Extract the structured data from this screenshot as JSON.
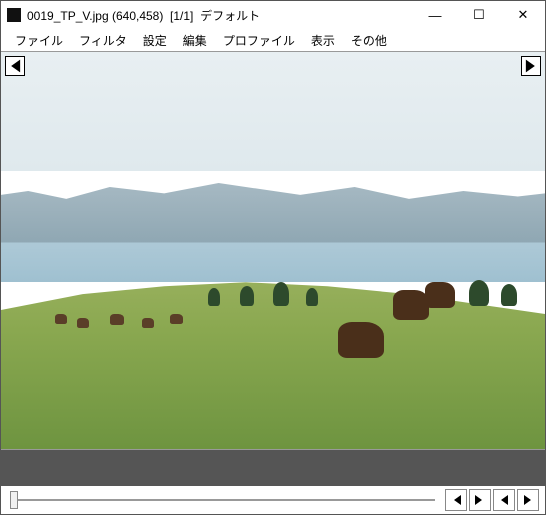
{
  "titlebar": {
    "filename": "0019_TP_V.jpg",
    "dimensions": "(640,458)",
    "page": "[1/1]",
    "profile": "デフォルト"
  },
  "menu": {
    "file": "ファイル",
    "filter": "フィルタ",
    "settings": "設定",
    "edit": "編集",
    "profile": "プロファイル",
    "view": "表示",
    "other": "その他"
  },
  "window_controls": {
    "minimize": "—",
    "maximize": "☐",
    "close": "✕"
  },
  "nav": {
    "first_arrow": "⇤",
    "last_arrow": "⇥"
  }
}
